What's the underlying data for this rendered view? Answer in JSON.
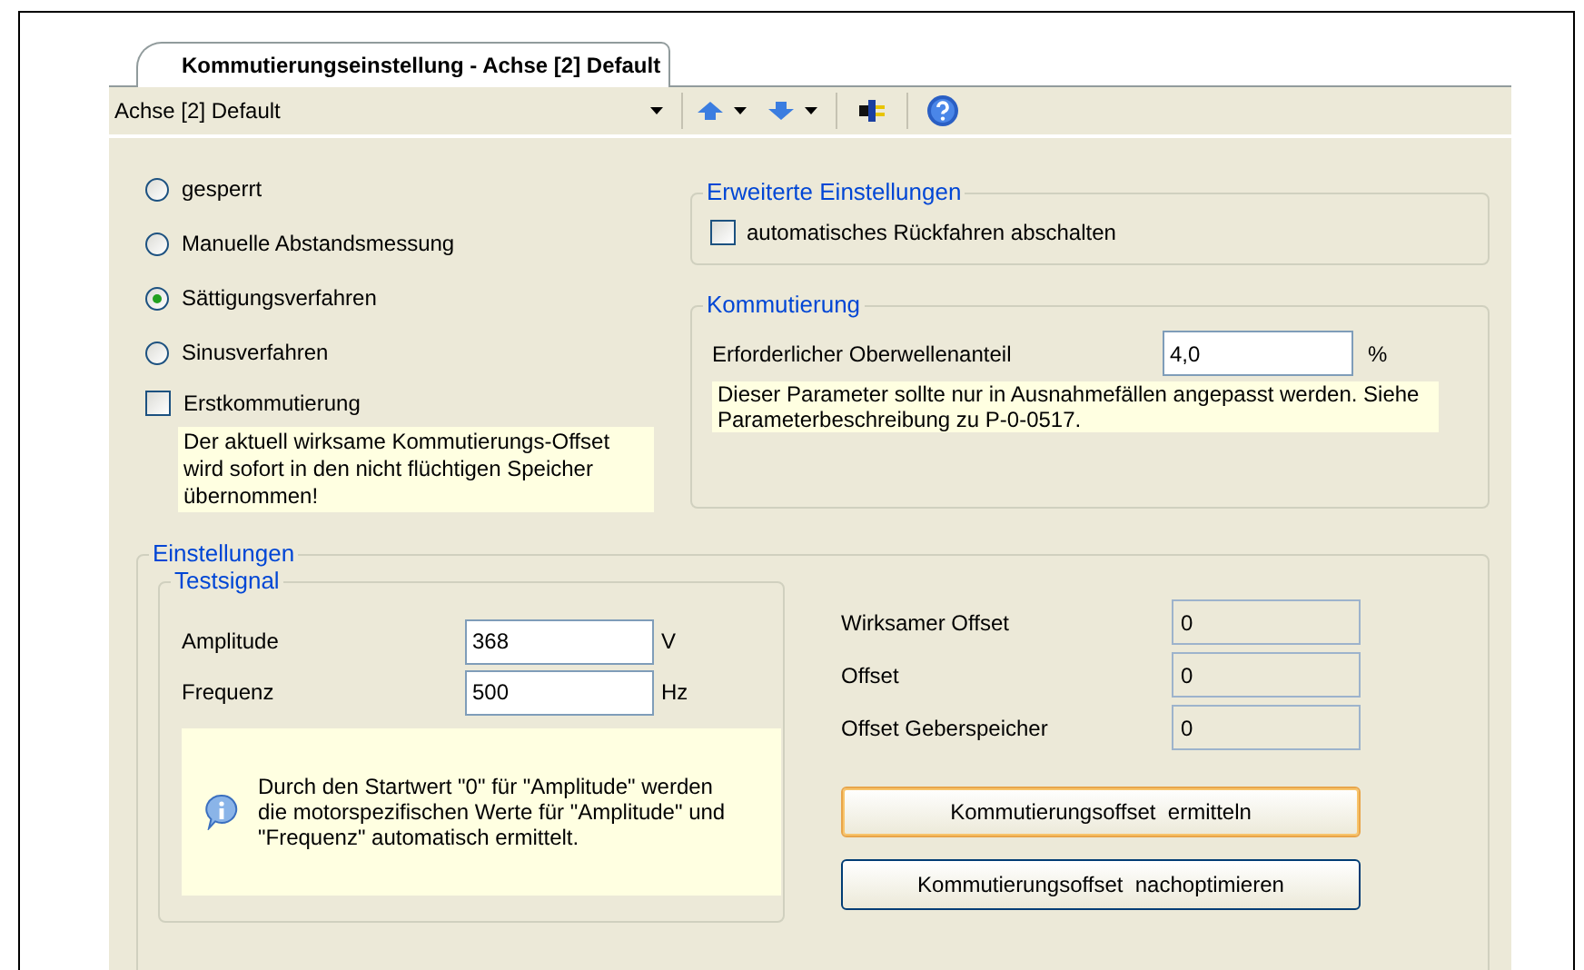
{
  "tab": {
    "label": "Kommutierungseinstellung - Achse [2] Default",
    "selected": true
  },
  "toolbar": {
    "axis": "Achse [2] Default"
  },
  "modes": [
    {
      "label": "gesperrt",
      "selected": false
    },
    {
      "label": "Manuelle Abstandsmessung",
      "selected": false
    },
    {
      "label": "Sättigungsverfahren",
      "selected": true
    },
    {
      "label": "Sinusverfahren",
      "selected": false
    }
  ],
  "first_commutation": {
    "label": "Erstkommutierung",
    "checked": false,
    "note": "Der aktuell wirksame Kommutierungs-Offset wird sofort in den nicht flüchtigen Speicher übernommen!"
  },
  "advanced": {
    "title": "Erweiterte Einstellungen",
    "option": {
      "label": "automatisches Rückfahren abschalten",
      "checked": false
    }
  },
  "commutation": {
    "title": "Kommutierung",
    "label": "Erforderlicher Oberwellenanteil",
    "value": "4,0",
    "unit": "%",
    "note": "Dieser Parameter sollte nur in Ausnahmefällen angepasst werden. Siehe Parameterbeschreibung zu P-0-0517."
  },
  "settings": {
    "title": "Einstellungen",
    "testsignal": {
      "title": "Testsignal",
      "fields": [
        {
          "label": "Amplitude",
          "value": "368",
          "unit": "V"
        },
        {
          "label": "Frequenz",
          "value": "500",
          "unit": "Hz"
        }
      ],
      "info": "Durch den Startwert \"0\" für \"Amplitude\" werden die motorspezifischen Werte für \"Amplitude\" und \"Frequenz\" automatisch ermittelt."
    },
    "readouts": [
      {
        "label": "Wirksamer Offset",
        "value": "0"
      },
      {
        "label": "Offset",
        "value": "0"
      },
      {
        "label": "Offset Geberspeicher",
        "value": "0"
      }
    ],
    "buttons": [
      {
        "label": "Kommutierungsoffset  ermitteln",
        "focused": true
      },
      {
        "label": "Kommutierungsoffset  nachoptimieren",
        "focused": false
      }
    ]
  }
}
